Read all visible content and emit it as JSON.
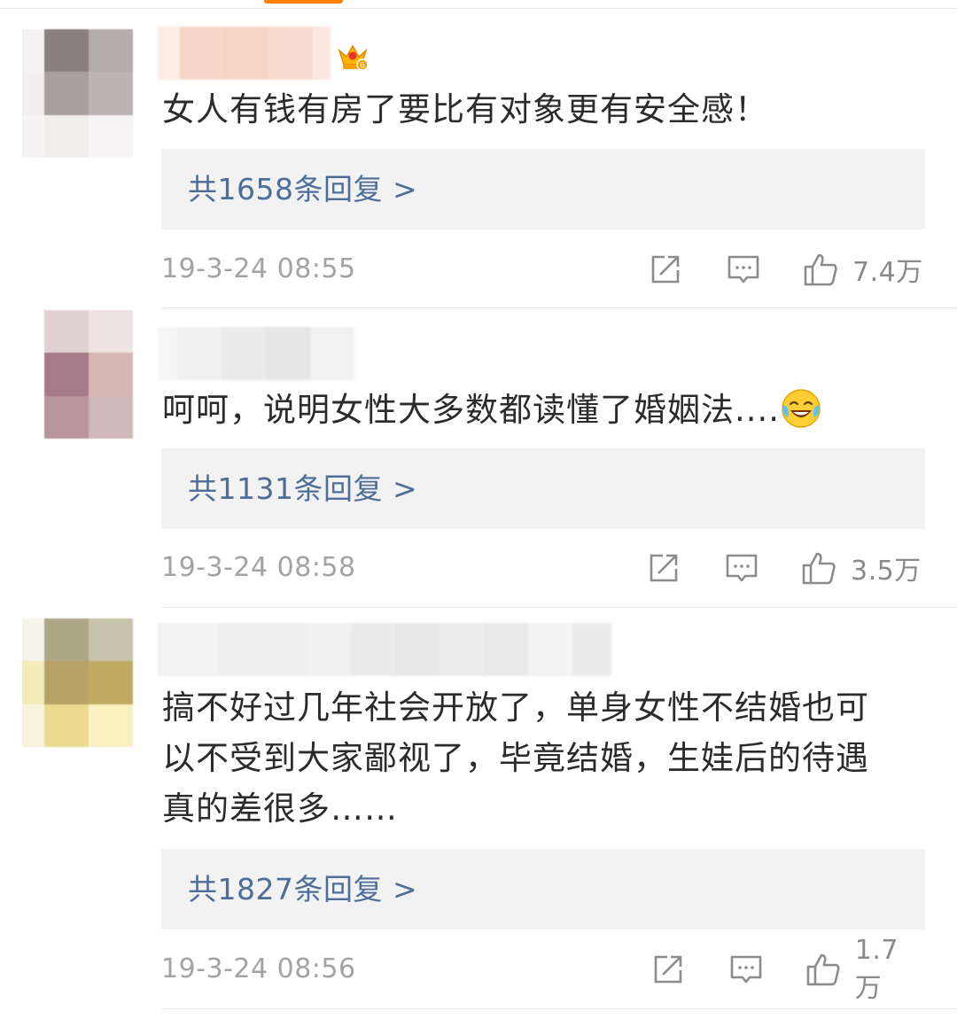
{
  "comments": [
    {
      "text": "女人有钱有房了要比有对象更有安全感！",
      "reply_label": "共1658条回复 >",
      "timestamp": "19-3-24 08:55",
      "likes": "7.4万",
      "badge": "crown-icon"
    },
    {
      "text": "呵呵，说明女性大多数都读懂了婚姻法....",
      "emoji": "laugh-cry-emoji-icon",
      "reply_label": "共1131条回复 >",
      "timestamp": "19-3-24 08:58",
      "likes": "3.5万"
    },
    {
      "text_lines": [
        "搞不好过几年社会开放了，单身女性不结婚也可",
        "以不受到大家鄙视了，毕竟结婚，生娃后的待遇",
        "真的差很多……"
      ],
      "reply_label": "共1827条回复 >",
      "timestamp": "19-3-24 08:56",
      "likes": "1.7万"
    }
  ],
  "icons": {
    "share": "share-icon",
    "comment": "comment-icon",
    "like": "thumbs-up-icon"
  },
  "colors": {
    "accent": "#ff8200",
    "reply_link": "#4e6e9a",
    "meta_text": "#a3a3a3",
    "reply_box_bg": "#f2f2f2"
  }
}
